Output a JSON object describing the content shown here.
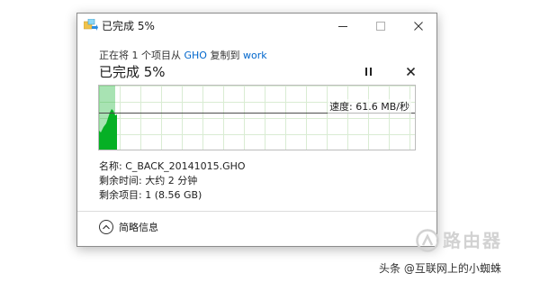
{
  "window": {
    "title": "已完成 5%",
    "icon": "copy-folder-icon"
  },
  "copy": {
    "text_before": "正在将 1 个项目从 ",
    "source": "GHO",
    "text_middle": " 复制到 ",
    "destination": "work",
    "heading": "已完成 5%",
    "progress_fraction": 0.05
  },
  "graph": {
    "speed_label": "速度: 61.6 MB/秒",
    "colors": {
      "fill": "#06b025",
      "grid": "#d9ecd3",
      "line": "#4d4d4d"
    }
  },
  "details": {
    "name_label": "名称: ",
    "name_value": "C_BACK_20141015.GHO",
    "time_label": "剩余时间: ",
    "time_value": "大约 2 分钟",
    "items_label": "剩余项目: ",
    "items_value": "1 (8.56 GB)"
  },
  "footer": {
    "toggle_label": "简略信息",
    "toggle_icon": "chevron-up-icon"
  },
  "watermark": {
    "brand": "路由器",
    "caption": "头条 @互联网上的小蜘蛛"
  }
}
